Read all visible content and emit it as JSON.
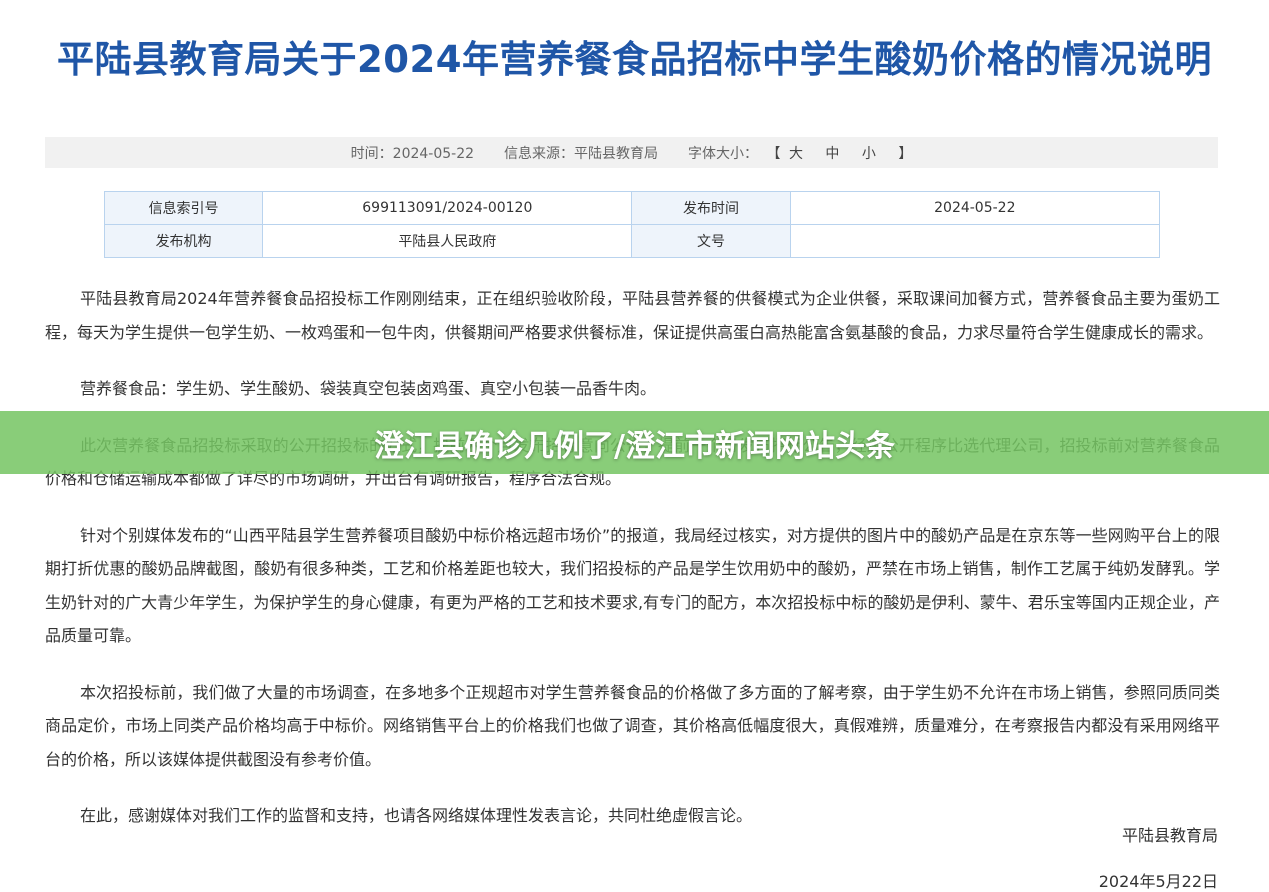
{
  "article": {
    "title": "平陆县教育局关于2024年营养餐食品招标中学生酸奶价格的情况说明"
  },
  "meta": {
    "time_label": "时间：2024-05-22",
    "source_label": "信息来源：平陆县教育局",
    "font_size_label": "字体大小：",
    "bracket_open": "【",
    "size_large": "大",
    "size_medium": "中",
    "size_small": "小",
    "bracket_close": "】"
  },
  "info_table": {
    "rows": [
      {
        "k1": "信息索引号",
        "v1": "699113091/2024-00120",
        "k2": "发布时间",
        "v2": "2024-05-22"
      },
      {
        "k1": "发布机构",
        "v1": "平陆县人民政府",
        "k2": "文号",
        "v2": ""
      }
    ]
  },
  "body": {
    "paragraphs": [
      "平陆县教育局2024年营养餐食品招投标工作刚刚结束，正在组织验收阶段，平陆县营养餐的供餐模式为企业供餐，采取课间加餐方式，营养餐食品主要为蛋奶工程，每天为学生提供一包学生奶、一枚鸡蛋和一包牛肉，供餐期间严格要求供餐标准，保证提供高蛋白高热能富含氨基酸的食品，力求尽量符合学生健康成长的需求。",
      "营养餐食品：学生奶、学生酸奶、袋装真空包装卤鸡蛋、真空小包装一品香牛肉。",
      "此次营养餐食品招投标采取的公开招投标的方式，提前两个月发布招标意向公告，提前一个月发布招标公告，经过公开程序比选代理公司，招投标前对营养餐食品价格和仓储运输成本都做了详尽的市场调研，并出台有调研报告，程序合法合规。",
      "针对个别媒体发布的“山西平陆县学生营养餐项目酸奶中标价格远超市场价”的报道，我局经过核实，对方提供的图片中的酸奶产品是在京东等一些网购平台上的限期打折优惠的酸奶品牌截图，酸奶有很多种类，工艺和价格差距也较大，我们招投标的产品是学生饮用奶中的酸奶，严禁在市场上销售，制作工艺属于纯奶发酵乳。学生奶针对的广大青少年学生，为保护学生的身心健康，有更为严格的工艺和技术要求,有专门的配方，本次招投标中标的酸奶是伊利、蒙牛、君乐宝等国内正规企业，产品质量可靠。",
      "本次招投标前，我们做了大量的市场调查，在多地多个正规超市对学生营养餐食品的价格做了多方面的了解考察，由于学生奶不允许在市场上销售，参照同质同类商品定价，市场上同类产品价格均高于中标价。网络销售平台上的价格我们也做了调查，其价格高低幅度很大，真假难辨，质量难分，在考察报告内都没有采用网络平台的价格，所以该媒体提供截图没有参考价值。",
      "在此，感谢媒体对我们工作的监督和支持，也请各网络媒体理性发表言论，共同杜绝虚假言论。"
    ],
    "signature_org": "平陆县教育局",
    "signature_date": "2024年5月22日"
  },
  "overlay": {
    "headline": "澄江县确诊几例了/澄江市新闻网站头条",
    "color": "#76c563"
  },
  "colors": {
    "title": "#1f56a7",
    "meta_bar_bg": "#f1f1f1",
    "table_border": "#b9d3ee",
    "table_key_bg": "#eef4fb"
  }
}
